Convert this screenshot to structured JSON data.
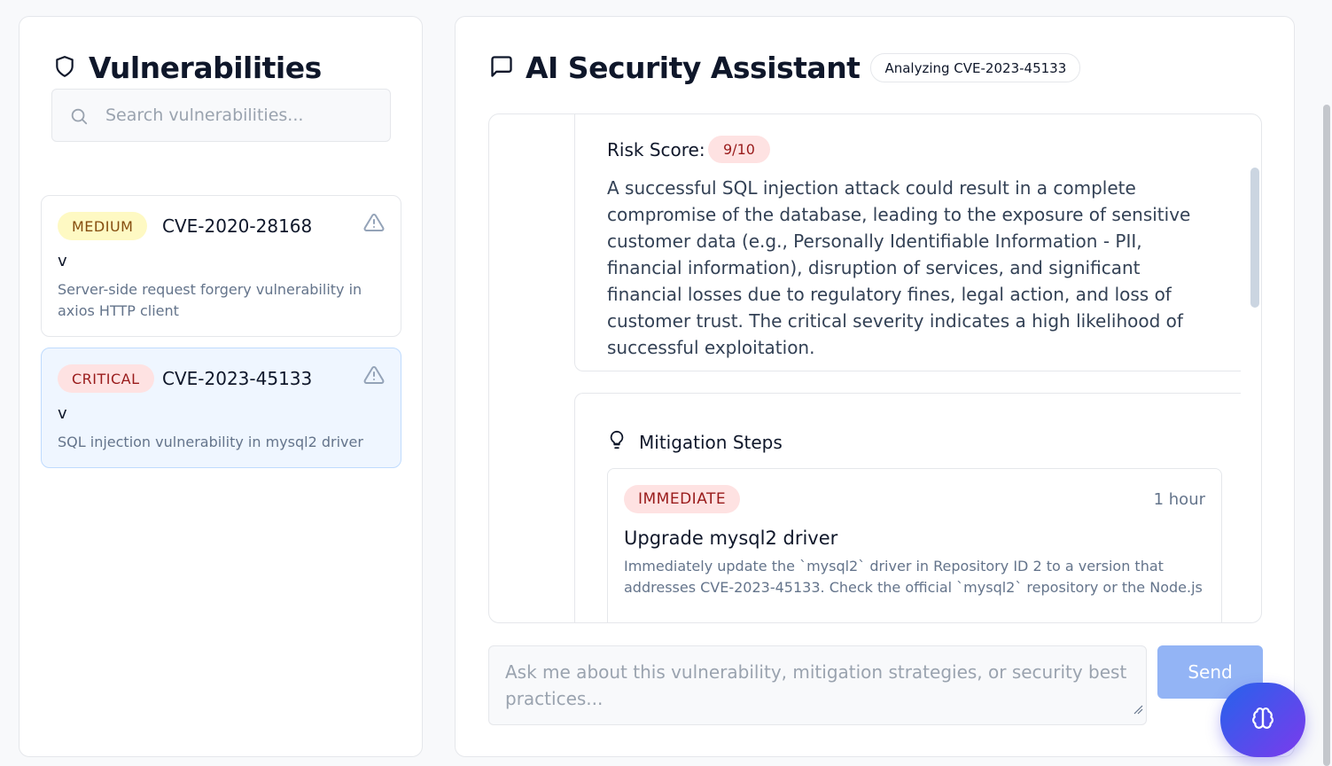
{
  "sidebar": {
    "title": "Vulnerabilities",
    "search_placeholder": "Search vulnerabilities...",
    "items": [
      {
        "severity": "MEDIUM",
        "cve": "CVE-2020-28168",
        "version": "v",
        "description": "Server-side request forgery vulnerability in axios HTTP client",
        "selected": false
      },
      {
        "severity": "CRITICAL",
        "cve": "CVE-2023-45133",
        "version": "v",
        "description": "SQL injection vulnerability in mysql2 driver",
        "selected": true
      }
    ]
  },
  "assistant": {
    "title": "AI Security Assistant",
    "context_pill": "Analyzing CVE-2023-45133",
    "risk": {
      "label": "Risk Score:",
      "score": "9/10",
      "text": "A successful SQL injection attack could result in a complete compromise of the database, leading to the exposure of sensitive customer data (e.g., Personally Identifiable Information - PII, financial information), disruption of services, and significant financial losses due to regulatory fines, legal action, and loss of customer trust. The critical severity indicates a high likelihood of successful exploitation."
    },
    "mitigation": {
      "title": "Mitigation Steps",
      "steps": [
        {
          "priority": "IMMEDIATE",
          "time": "1 hour",
          "title": "Upgrade mysql2 driver",
          "description": "Immediately update the `mysql2` driver in Repository ID 2 to a version that addresses CVE-2023-45133. Check the official `mysql2` repository or the Node.js"
        }
      ]
    },
    "input_placeholder": "Ask me about this vulnerability, mitigation strategies, or security best practices...",
    "send_label": "Send"
  },
  "colors": {
    "medium_bg": "#fef9c3",
    "critical_bg": "#fee2e2",
    "send_bg": "#93b4f5",
    "fab_gradient_start": "#2563eb",
    "fab_gradient_end": "#7c3aed"
  }
}
